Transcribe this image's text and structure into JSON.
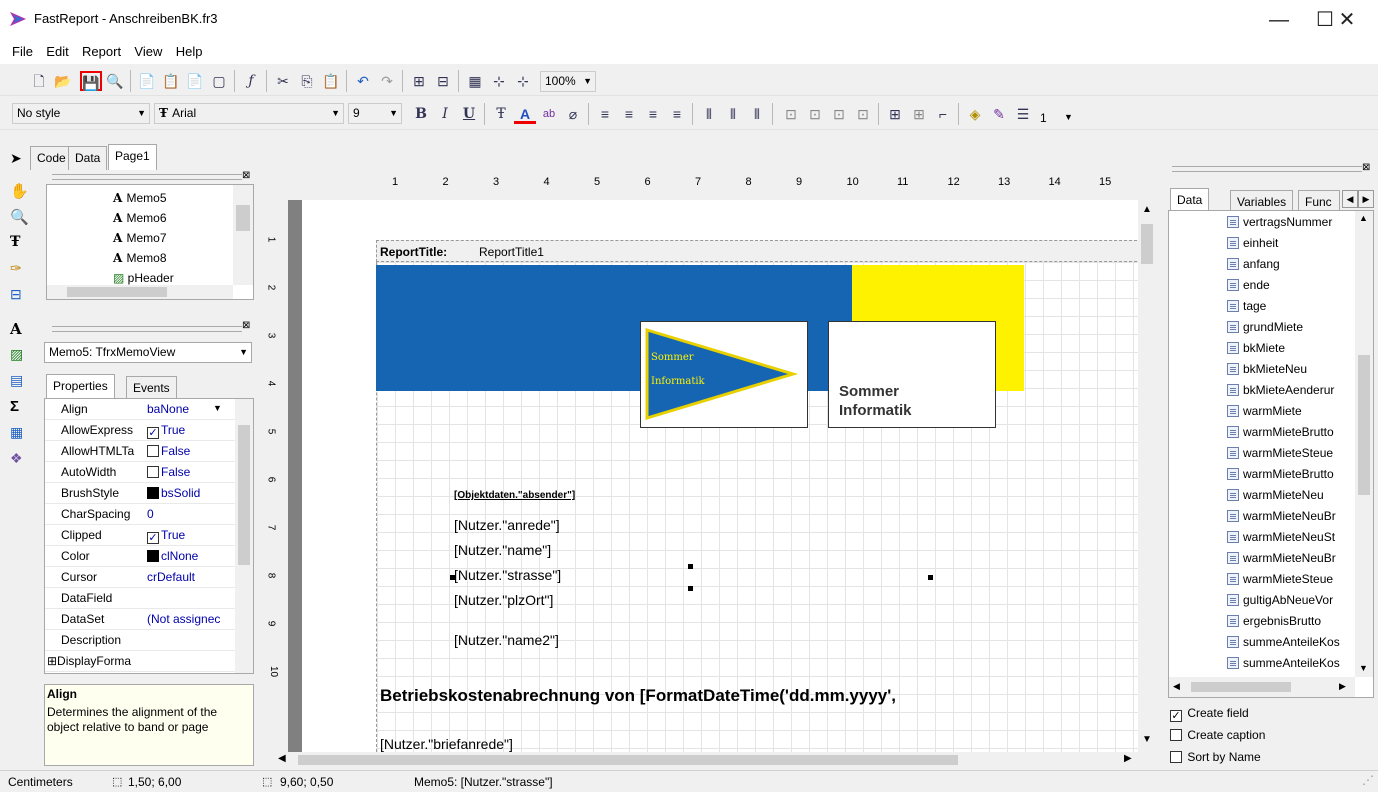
{
  "window": {
    "title": "FastReport - AnschreibenBK.fr3",
    "minimize": "—",
    "maximize": "☐",
    "close": "✕"
  },
  "menu": [
    "File",
    "Edit",
    "Report",
    "View",
    "Help"
  ],
  "toolbar": {
    "zoom": "100%",
    "style": "No style",
    "font": "Arial",
    "font_size": "9",
    "frame_width": "1"
  },
  "tabs": {
    "code": "Code",
    "data": "Data",
    "page": "Page1"
  },
  "report_tree": [
    "Memo5",
    "Memo6",
    "Memo7",
    "Memo8",
    "pHeader"
  ],
  "object_selector": "Memo5: TfrxMemoView",
  "inspector_tabs": {
    "properties": "Properties",
    "events": "Events"
  },
  "properties": [
    {
      "name": "Align",
      "value": "baNone"
    },
    {
      "name": "AllowExpress",
      "value": "True",
      "check": "on"
    },
    {
      "name": "AllowHTMLTa",
      "value": "False",
      "check": "off"
    },
    {
      "name": "AutoWidth",
      "value": "False",
      "check": "off"
    },
    {
      "name": "BrushStyle",
      "value": "bsSolid",
      "swatch": "#000000"
    },
    {
      "name": "CharSpacing",
      "value": "0"
    },
    {
      "name": "Clipped",
      "value": "True",
      "check": "on"
    },
    {
      "name": "Color",
      "value": "clNone",
      "swatch": "#000000"
    },
    {
      "name": "Cursor",
      "value": "crDefault"
    },
    {
      "name": "DataField",
      "value": ""
    },
    {
      "name": "DataSet",
      "value": "(Not assignec"
    },
    {
      "name": "Description",
      "value": ""
    },
    {
      "name": "⊞DisplayForma",
      "value": ""
    }
  ],
  "help": {
    "title": "Align",
    "text": "Determines the alignment of the object relative to band or page"
  },
  "ruler_h": [
    "1",
    "2",
    "3",
    "4",
    "5",
    "6",
    "7",
    "8",
    "9",
    "10",
    "11",
    "12",
    "13",
    "14",
    "15"
  ],
  "ruler_v": [
    "1",
    "2",
    "3",
    "4",
    "5",
    "6",
    "7",
    "8",
    "9",
    "10"
  ],
  "band_label": {
    "kind": "ReportTitle:",
    "name": "ReportTitle1"
  },
  "logo": {
    "line1": "Sommer",
    "line2": "Informatik",
    "text": "Sommer Informatik",
    "blue": "#1565b3",
    "yellow": "#fff200"
  },
  "memos": {
    "absender": "[Objektdaten.\"absender\"]",
    "anrede": "[Nutzer.\"anrede\"]",
    "name": "[Nutzer.\"name\"]",
    "strasse": "[Nutzer.\"strasse\"]",
    "plzort": "[Nutzer.\"plzOrt\"]",
    "name2": "[Nutzer.\"name2\"]",
    "heading": "Betriebskostenabrechnung von [FormatDateTime('dd.mm.yyyy',",
    "briefanrede": "[Nutzer.\"briefanrede\"]"
  },
  "data_panel_tabs": {
    "data": "Data",
    "variables": "Variables",
    "functions": "Func"
  },
  "data_fields": [
    "vertragsNummer",
    "einheit",
    "anfang",
    "ende",
    "tage",
    "grundMiete",
    "bkMiete",
    "bkMieteNeu",
    "bkMieteAenderur",
    "warmMiete",
    "warmMieteBrutto",
    "warmMieteSteue",
    "warmMieteBrutto",
    "warmMieteNeu",
    "warmMieteNeuBr",
    "warmMieteNeuSt",
    "warmMieteNeuBr",
    "warmMieteSteue",
    "gultigAbNeueVor",
    "ergebnisBrutto",
    "summeAnteileKos",
    "summeAnteileKos"
  ],
  "options": {
    "create_field": "Create field",
    "create_caption": "Create caption",
    "sort_by_name": "Sort by Name"
  },
  "status": {
    "units": "Centimeters",
    "pos": "1,50; 6,00",
    "size": "9,60; 0,50",
    "info": "Memo5: [Nutzer.\"strasse\"]"
  }
}
